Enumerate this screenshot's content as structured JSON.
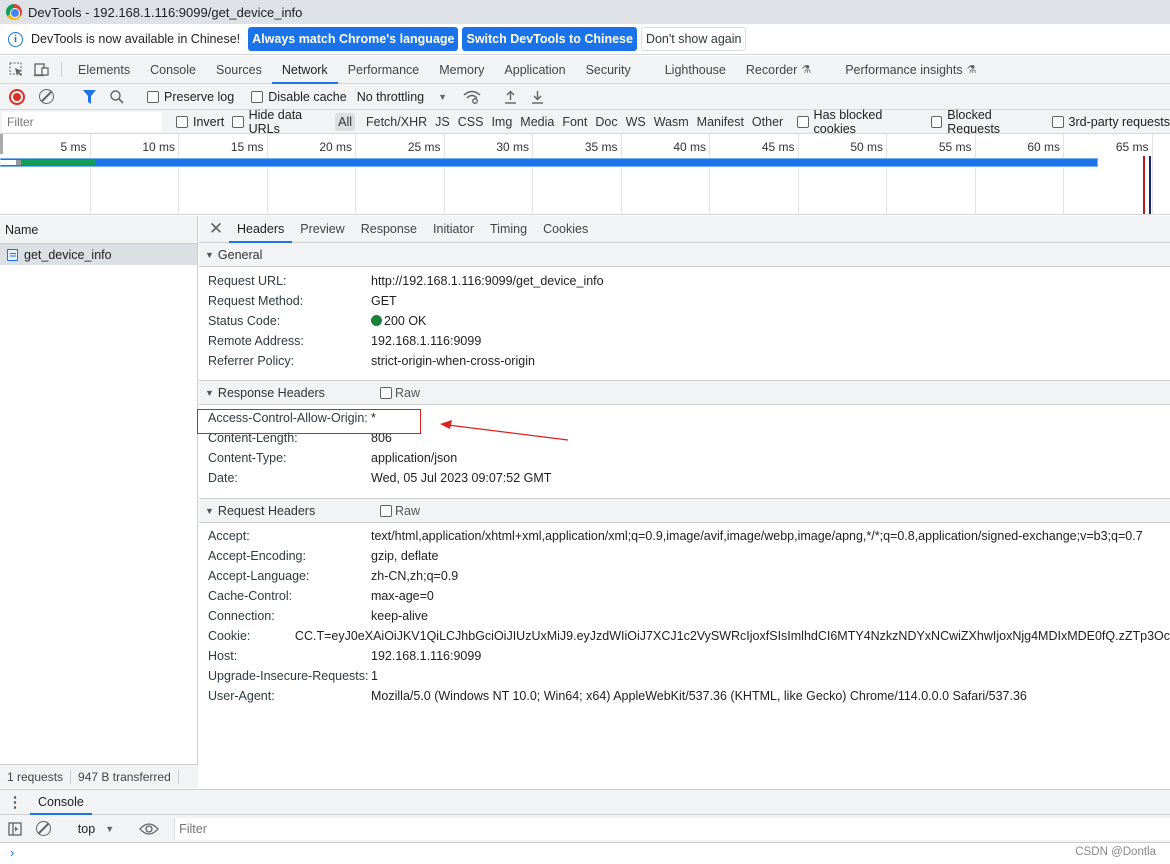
{
  "window": {
    "title": "DevTools - 192.168.1.116:9099/get_device_info"
  },
  "infobar": {
    "message": "DevTools is now available in Chinese!",
    "btn_match": "Always match Chrome's language",
    "btn_switch": "Switch DevTools to Chinese",
    "btn_dismiss": "Don't show again"
  },
  "panel_tabs": [
    "Elements",
    "Console",
    "Sources",
    "Network",
    "Performance",
    "Memory",
    "Application",
    "Security",
    "Lighthouse",
    "Recorder",
    "Performance insights"
  ],
  "active_panel": "Network",
  "toolbar": {
    "preserve_log": "Preserve log",
    "disable_cache": "Disable cache",
    "throttling": "No throttling"
  },
  "filterbar": {
    "placeholder": "Filter",
    "invert": "Invert",
    "hide_data_urls": "Hide data URLs",
    "types": [
      "All",
      "Fetch/XHR",
      "JS",
      "CSS",
      "Img",
      "Media",
      "Font",
      "Doc",
      "WS",
      "Wasm",
      "Manifest",
      "Other"
    ],
    "selected_type": "All",
    "has_blocked_cookies": "Has blocked cookies",
    "blocked_requests": "Blocked Requests",
    "third_party": "3rd-party requests"
  },
  "overview": {
    "ticks": [
      "5 ms",
      "10 ms",
      "15 ms",
      "20 ms",
      "25 ms",
      "30 ms",
      "35 ms",
      "40 ms",
      "45 ms",
      "50 ms",
      "55 ms",
      "60 ms",
      "65 ms"
    ],
    "request_end_ms": 62,
    "dom_content_loaded_ms": 62.4,
    "load_ms": 62.6
  },
  "requests": {
    "column": "Name",
    "items": [
      {
        "name": "get_device_info"
      }
    ],
    "status_count": "1 requests",
    "status_transferred": "947 B transferred"
  },
  "detail_tabs": [
    "Headers",
    "Preview",
    "Response",
    "Initiator",
    "Timing",
    "Cookies"
  ],
  "active_detail_tab": "Headers",
  "general": {
    "title": "General",
    "rows": [
      {
        "k": "Request URL:",
        "v": "http://192.168.1.116:9099/get_device_info"
      },
      {
        "k": "Request Method:",
        "v": "GET"
      },
      {
        "k": "Status Code:",
        "v": "200 OK",
        "status_color": "#188038"
      },
      {
        "k": "Remote Address:",
        "v": "192.168.1.116:9099"
      },
      {
        "k": "Referrer Policy:",
        "v": "strict-origin-when-cross-origin"
      }
    ]
  },
  "response_headers": {
    "title": "Response Headers",
    "raw_label": "Raw",
    "rows": [
      {
        "k": "Access-Control-Allow-Origin:",
        "v": "*"
      },
      {
        "k": "Content-Length:",
        "v": "806"
      },
      {
        "k": "Content-Type:",
        "v": "application/json"
      },
      {
        "k": "Date:",
        "v": "Wed, 05 Jul 2023 09:07:52 GMT"
      }
    ]
  },
  "request_headers": {
    "title": "Request Headers",
    "raw_label": "Raw",
    "rows": [
      {
        "k": "Accept:",
        "v": "text/html,application/xhtml+xml,application/xml;q=0.9,image/avif,image/webp,image/apng,*/*;q=0.8,application/signed-exchange;v=b3;q=0.7"
      },
      {
        "k": "Accept-Encoding:",
        "v": "gzip, deflate"
      },
      {
        "k": "Accept-Language:",
        "v": "zh-CN,zh;q=0.9"
      },
      {
        "k": "Cache-Control:",
        "v": "max-age=0"
      },
      {
        "k": "Connection:",
        "v": "keep-alive"
      },
      {
        "k": "Cookie:",
        "v": "CC.T=eyJ0eXAiOiJKV1QiLCJhbGciOiJIUzUxMiJ9.eyJzdWIiOiJ7XCJ1c2VySWRcIjoxfSIsImlhdCI6MTY4NzkzNDYxNCwiZXhwIjoxNjg4MDIxMDE0fQ.zZTp3Oc"
      },
      {
        "k": "Host:",
        "v": "192.168.1.116:9099"
      },
      {
        "k": "Upgrade-Insecure-Requests:",
        "v": "1"
      },
      {
        "k": "User-Agent:",
        "v": "Mozilla/5.0 (Windows NT 10.0; Win64; x64) AppleWebKit/537.36 (KHTML, like Gecko) Chrome/114.0.0.0 Safari/537.36"
      }
    ]
  },
  "console": {
    "tab": "Console",
    "context": "top",
    "filter_placeholder": "Filter"
  },
  "watermark": "CSDN @Dontla",
  "colors": {
    "accent": "#1a73e8",
    "annotation": "#e0201c"
  }
}
